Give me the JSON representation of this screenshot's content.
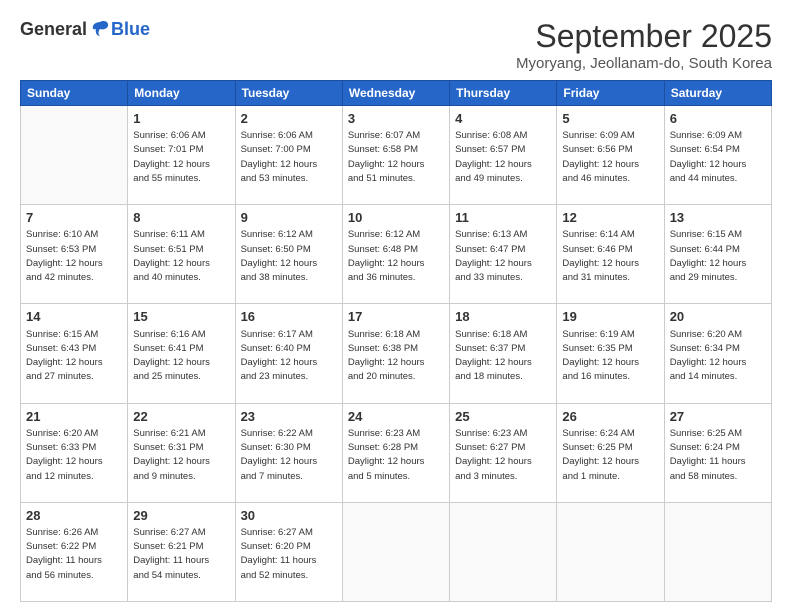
{
  "logo": {
    "general": "General",
    "blue": "Blue"
  },
  "header": {
    "month": "September 2025",
    "location": "Myoryang, Jeollanam-do, South Korea"
  },
  "days_of_week": [
    "Sunday",
    "Monday",
    "Tuesday",
    "Wednesday",
    "Thursday",
    "Friday",
    "Saturday"
  ],
  "weeks": [
    [
      {
        "day": "",
        "info": ""
      },
      {
        "day": "1",
        "info": "Sunrise: 6:06 AM\nSunset: 7:01 PM\nDaylight: 12 hours\nand 55 minutes."
      },
      {
        "day": "2",
        "info": "Sunrise: 6:06 AM\nSunset: 7:00 PM\nDaylight: 12 hours\nand 53 minutes."
      },
      {
        "day": "3",
        "info": "Sunrise: 6:07 AM\nSunset: 6:58 PM\nDaylight: 12 hours\nand 51 minutes."
      },
      {
        "day": "4",
        "info": "Sunrise: 6:08 AM\nSunset: 6:57 PM\nDaylight: 12 hours\nand 49 minutes."
      },
      {
        "day": "5",
        "info": "Sunrise: 6:09 AM\nSunset: 6:56 PM\nDaylight: 12 hours\nand 46 minutes."
      },
      {
        "day": "6",
        "info": "Sunrise: 6:09 AM\nSunset: 6:54 PM\nDaylight: 12 hours\nand 44 minutes."
      }
    ],
    [
      {
        "day": "7",
        "info": "Sunrise: 6:10 AM\nSunset: 6:53 PM\nDaylight: 12 hours\nand 42 minutes."
      },
      {
        "day": "8",
        "info": "Sunrise: 6:11 AM\nSunset: 6:51 PM\nDaylight: 12 hours\nand 40 minutes."
      },
      {
        "day": "9",
        "info": "Sunrise: 6:12 AM\nSunset: 6:50 PM\nDaylight: 12 hours\nand 38 minutes."
      },
      {
        "day": "10",
        "info": "Sunrise: 6:12 AM\nSunset: 6:48 PM\nDaylight: 12 hours\nand 36 minutes."
      },
      {
        "day": "11",
        "info": "Sunrise: 6:13 AM\nSunset: 6:47 PM\nDaylight: 12 hours\nand 33 minutes."
      },
      {
        "day": "12",
        "info": "Sunrise: 6:14 AM\nSunset: 6:46 PM\nDaylight: 12 hours\nand 31 minutes."
      },
      {
        "day": "13",
        "info": "Sunrise: 6:15 AM\nSunset: 6:44 PM\nDaylight: 12 hours\nand 29 minutes."
      }
    ],
    [
      {
        "day": "14",
        "info": "Sunrise: 6:15 AM\nSunset: 6:43 PM\nDaylight: 12 hours\nand 27 minutes."
      },
      {
        "day": "15",
        "info": "Sunrise: 6:16 AM\nSunset: 6:41 PM\nDaylight: 12 hours\nand 25 minutes."
      },
      {
        "day": "16",
        "info": "Sunrise: 6:17 AM\nSunset: 6:40 PM\nDaylight: 12 hours\nand 23 minutes."
      },
      {
        "day": "17",
        "info": "Sunrise: 6:18 AM\nSunset: 6:38 PM\nDaylight: 12 hours\nand 20 minutes."
      },
      {
        "day": "18",
        "info": "Sunrise: 6:18 AM\nSunset: 6:37 PM\nDaylight: 12 hours\nand 18 minutes."
      },
      {
        "day": "19",
        "info": "Sunrise: 6:19 AM\nSunset: 6:35 PM\nDaylight: 12 hours\nand 16 minutes."
      },
      {
        "day": "20",
        "info": "Sunrise: 6:20 AM\nSunset: 6:34 PM\nDaylight: 12 hours\nand 14 minutes."
      }
    ],
    [
      {
        "day": "21",
        "info": "Sunrise: 6:20 AM\nSunset: 6:33 PM\nDaylight: 12 hours\nand 12 minutes."
      },
      {
        "day": "22",
        "info": "Sunrise: 6:21 AM\nSunset: 6:31 PM\nDaylight: 12 hours\nand 9 minutes."
      },
      {
        "day": "23",
        "info": "Sunrise: 6:22 AM\nSunset: 6:30 PM\nDaylight: 12 hours\nand 7 minutes."
      },
      {
        "day": "24",
        "info": "Sunrise: 6:23 AM\nSunset: 6:28 PM\nDaylight: 12 hours\nand 5 minutes."
      },
      {
        "day": "25",
        "info": "Sunrise: 6:23 AM\nSunset: 6:27 PM\nDaylight: 12 hours\nand 3 minutes."
      },
      {
        "day": "26",
        "info": "Sunrise: 6:24 AM\nSunset: 6:25 PM\nDaylight: 12 hours\nand 1 minute."
      },
      {
        "day": "27",
        "info": "Sunrise: 6:25 AM\nSunset: 6:24 PM\nDaylight: 11 hours\nand 58 minutes."
      }
    ],
    [
      {
        "day": "28",
        "info": "Sunrise: 6:26 AM\nSunset: 6:22 PM\nDaylight: 11 hours\nand 56 minutes."
      },
      {
        "day": "29",
        "info": "Sunrise: 6:27 AM\nSunset: 6:21 PM\nDaylight: 11 hours\nand 54 minutes."
      },
      {
        "day": "30",
        "info": "Sunrise: 6:27 AM\nSunset: 6:20 PM\nDaylight: 11 hours\nand 52 minutes."
      },
      {
        "day": "",
        "info": ""
      },
      {
        "day": "",
        "info": ""
      },
      {
        "day": "",
        "info": ""
      },
      {
        "day": "",
        "info": ""
      }
    ]
  ]
}
